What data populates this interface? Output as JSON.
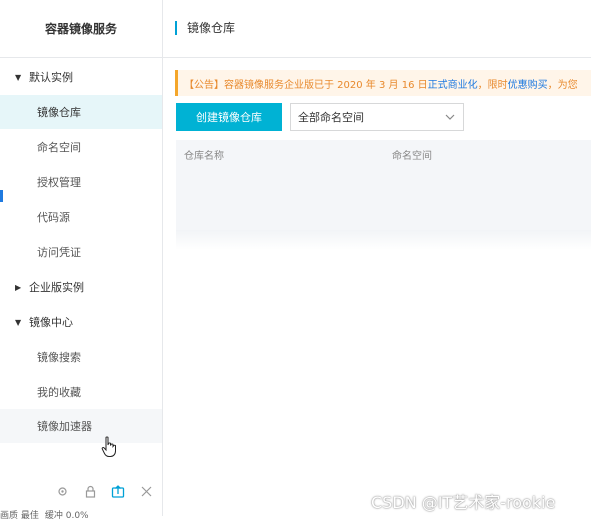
{
  "sidebar": {
    "title": "容器镜像服务",
    "groups": [
      {
        "label": "默认实例",
        "expanded": true
      },
      {
        "label": "企业版实例",
        "expanded": false
      },
      {
        "label": "镜像中心",
        "expanded": true
      }
    ],
    "default_items": [
      "镜像仓库",
      "命名空间",
      "授权管理",
      "代码源",
      "访问凭证"
    ],
    "center_items": [
      "镜像搜索",
      "我的收藏",
      "镜像加速器"
    ],
    "active_item": "镜像仓库"
  },
  "status": {
    "left": "画质 最佳",
    "right": "缓冲 0.0%"
  },
  "header": {
    "title": "镜像仓库"
  },
  "notice": {
    "text_a": "【公告】容器镜像服务企业版已于 2020 年 3 月 16 日",
    "link_a": "正式商业化",
    "text_b": "，限时",
    "link_b": "优惠购买",
    "text_c": "，为您"
  },
  "toolbar": {
    "create_label": "创建镜像仓库",
    "namespace_value": "全部命名空间"
  },
  "table": {
    "columns": [
      "仓库名称",
      "命名空间"
    ]
  },
  "watermark": "CSDN @IT艺术家-rookie",
  "colors": {
    "accent": "#00b2d4",
    "notice_border": "#f4a62a",
    "link": "#1f7ae0"
  }
}
